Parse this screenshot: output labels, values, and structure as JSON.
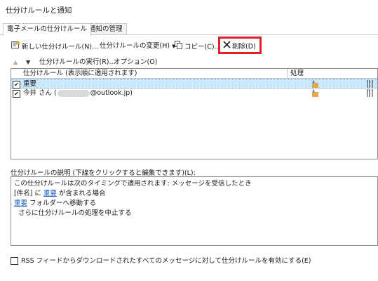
{
  "window": {
    "title": "仕分けルールと通知"
  },
  "tabs": [
    {
      "label": "電子メールの仕分けルール"
    },
    {
      "label": "通知の管理"
    }
  ],
  "toolbar": {
    "new_rule": "新しい仕分けルール(N)...",
    "change_rule": "仕分けルールの変更(H)",
    "copy": "コピー(C)...",
    "delete": "削除(D)",
    "run_rules": "仕分けルールの実行(R)...",
    "options": "オプション(O)"
  },
  "rules_table": {
    "headers": [
      "仕分けルール (表示順に適用されます)",
      "処理"
    ],
    "rows": [
      {
        "name": "重要",
        "checked": true,
        "selected": true
      },
      {
        "name_prefix": "今井 さん (",
        "name_suffix": "@outlook.jp)",
        "checked": true,
        "selected": false
      }
    ]
  },
  "description": {
    "label": "仕分けルールの説明 (下線をクリックすると編集できます)(L):",
    "line1": "この仕分けルールは次のタイミングで適用されます: メッセージを受信したとき",
    "line2_pre": "[件名] に ",
    "line2_link": "重要",
    "line2_post": " が含まれる場合",
    "line3_link": "重要",
    "line3_post": " フォルダーへ移動する",
    "line4": "さらに仕分けルールの処理を中止する"
  },
  "rss": {
    "label": "RSS フィードからダウンロードされたすべてのメッセージに対して仕分けルールを有効にする(E)",
    "checked": false
  },
  "colors": {
    "highlight": "#e0212b",
    "selection": "#cce8ff",
    "link": "#1f5fbf"
  }
}
